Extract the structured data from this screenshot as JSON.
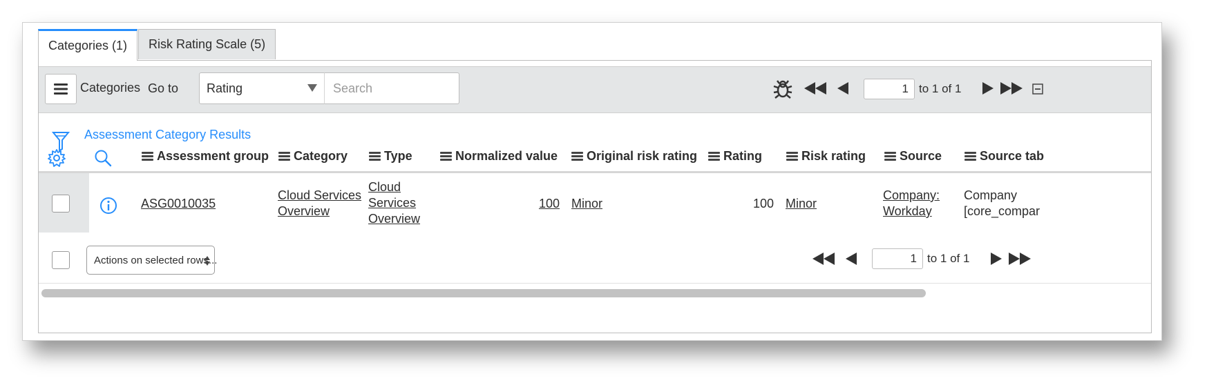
{
  "tabs": [
    {
      "label": "Categories (1)"
    },
    {
      "label": "Risk Rating Scale (5)"
    }
  ],
  "toolbar": {
    "title": "Categories",
    "goto_label": "Go to",
    "field_select": "Rating",
    "search_placeholder": "Search",
    "page_value": "1",
    "page_info": "to 1 of 1"
  },
  "breadcrumb": "Assessment Category Results",
  "columns": [
    "Assessment group",
    "Category",
    "Type",
    "Normalized value",
    "Original risk rating",
    "Rating",
    "Risk rating",
    "Source",
    "Source tab"
  ],
  "row": {
    "assessment_group": "ASG0010035",
    "category_line1": "Cloud Services",
    "category_line2": "Overview",
    "type_line1": "Cloud",
    "type_line2": "Services",
    "type_line3": "Overview",
    "normalized_value": "100",
    "original_risk_rating": "Minor",
    "rating": "100",
    "risk_rating": "Minor",
    "source_line1": "Company:",
    "source_line2": "Workday",
    "source_table_line1": "Company",
    "source_table_line2": "[core_compar"
  },
  "footer": {
    "actions_label": "Actions on selected rows...",
    "page_value": "1",
    "page_info": "to 1 of 1"
  },
  "colors": {
    "accent": "#278efc",
    "toolbar_bg": "#e4e6e7"
  }
}
